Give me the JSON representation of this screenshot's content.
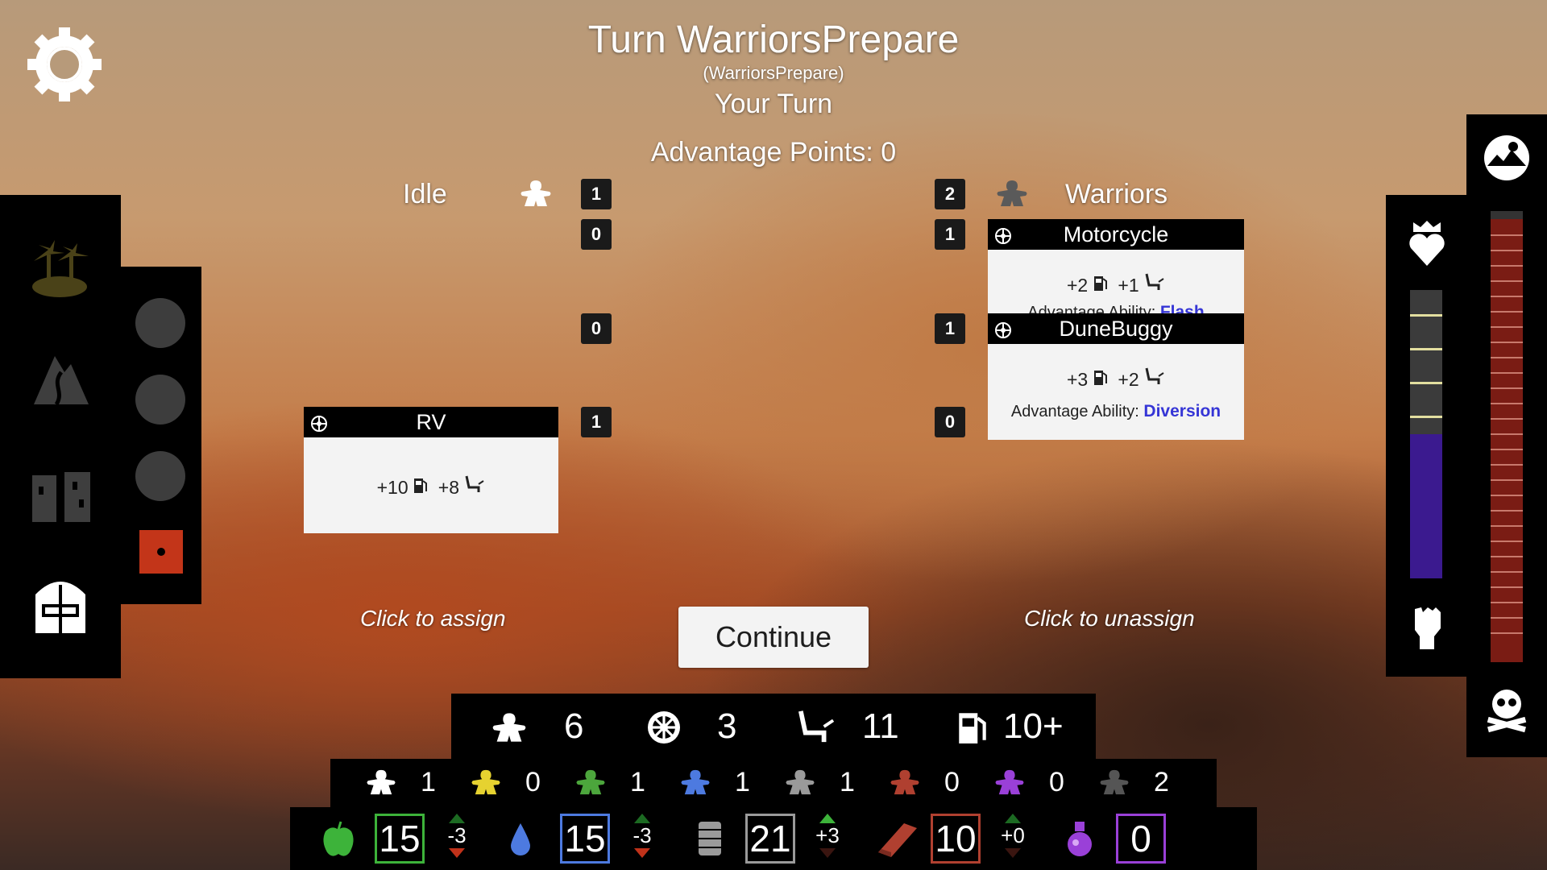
{
  "header": {
    "title": "Turn WarriorsPrepare",
    "subtitle": "(WarriorsPrepare)",
    "turn_status": "Your Turn",
    "advantage_points": "Advantage Points: 0"
  },
  "columns": {
    "left_label": "Idle",
    "left_count": "1",
    "right_label": "Warriors",
    "right_count": "2"
  },
  "rows": [
    {
      "left": "0",
      "right": "1"
    },
    {
      "left": "0",
      "right": "1"
    },
    {
      "left": "1",
      "right": "0"
    }
  ],
  "cards": {
    "motorcycle": {
      "name": "Motorcycle",
      "fuel": "+2",
      "seats": "+1",
      "adv_label": "Advantage Ability:",
      "adv_name": "Flash"
    },
    "dunebuggy": {
      "name": "DuneBuggy",
      "fuel": "+3",
      "seats": "+2",
      "adv_label": "Advantage Ability:",
      "adv_name": "Diversion"
    },
    "rv": {
      "name": "RV",
      "fuel": "+10",
      "seats": "+8"
    }
  },
  "hints": {
    "assign": "Click to assign",
    "unassign": "Click to unassign"
  },
  "continue_label": "Continue",
  "summary": {
    "people": "6",
    "vehicles": "3",
    "seats": "11",
    "fuel": "10+"
  },
  "factions": [
    {
      "color": "#ffffff",
      "count": "1"
    },
    {
      "color": "#e6d230",
      "count": "0"
    },
    {
      "color": "#4ca63c",
      "count": "1"
    },
    {
      "color": "#4d7ae0",
      "count": "1"
    },
    {
      "color": "#9a9a9a",
      "count": "1"
    },
    {
      "color": "#b04030",
      "count": "0"
    },
    {
      "color": "#9a40d8",
      "count": "0"
    },
    {
      "color": "#555555",
      "count": "2"
    }
  ],
  "resources": {
    "food": {
      "value": "15",
      "delta": "-3",
      "color": "#3db33a"
    },
    "water": {
      "value": "15",
      "delta": "-3",
      "color": "#4d7ae0"
    },
    "fuel": {
      "value": "21",
      "delta": "+3",
      "color": "#9a9a9a"
    },
    "materials": {
      "value": "10",
      "delta": "+0",
      "color": "#b04030"
    },
    "medicine": {
      "value": "0",
      "color": "#9a40d8"
    }
  },
  "meters": {
    "morale_fraction": 0.5,
    "threat_fraction": 1.0
  }
}
